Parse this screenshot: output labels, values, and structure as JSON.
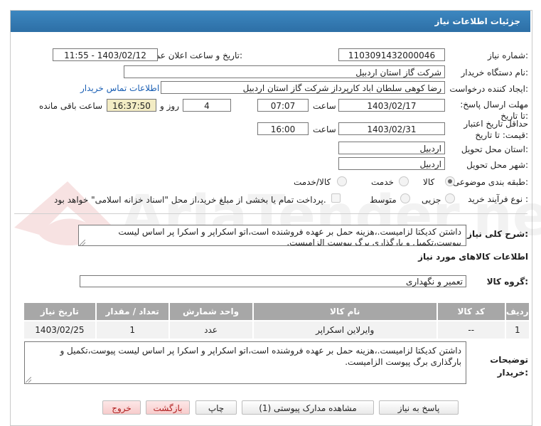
{
  "title": "جزئیات اطلاعات نیاز",
  "need_number": {
    "label": "شماره نیاز:",
    "value": "1103091432000046"
  },
  "announce": {
    "label": "تاریخ و ساعت اعلان عمومی:",
    "value": "1403/02/12 - 11:55"
  },
  "buyer": {
    "label": "نام دستگاه خریدار:",
    "value": "شرکت گاز استان اردبیل"
  },
  "creator": {
    "label": "ایجاد کننده درخواست:",
    "value": "رضا کوهی سلطان اباد کارپرداز شرکت گاز استان اردبیل",
    "contact_link": "اطلاعات تماس خریدار"
  },
  "deadline": {
    "label": "مهلت ارسال پاسخ: تا تاریخ:",
    "date": "1403/02/17",
    "time_label": "ساعت",
    "time": "07:07",
    "days": "4",
    "days_label": "روز و",
    "remaining": "16:37:50",
    "remaining_label": "ساعت باقی مانده"
  },
  "validity": {
    "label": "حداقل تاریخ اعتبار قیمت: تا تاریخ:",
    "date": "1403/02/31",
    "time_label": "ساعت",
    "time": "16:00"
  },
  "province": {
    "label": "استان محل تحویل:",
    "value": "اردبیل"
  },
  "city": {
    "label": "شهر محل تحویل:",
    "value": "اردبیل"
  },
  "category": {
    "label": "طبقه بندی موضوعی:",
    "options": [
      "کالا",
      "خدمت",
      "کالا/خدمت"
    ],
    "selected": "کالا"
  },
  "process": {
    "label": "نوع فرآیند خرید :",
    "options": [
      "جزیی",
      "متوسط"
    ],
    "selected": "جزیی",
    "checkbox_text": "پرداخت تمام یا بخشی از مبلغ خرید،از محل \"اسناد خزانه اسلامی\" خواهد بود."
  },
  "summary": {
    "label": "شرح کلی نیاز:",
    "value": "داشتن کدیکتا لزامیست.،هزینه حمل بر عهده فروشنده است،اتو اسکراپر و اسکرا پر اساس لیست پیوست،تکمیل و بارگذاری برگ پیوست الزامیست."
  },
  "goods_section": "اطلاعات کالاهای مورد نیاز",
  "goods_group": {
    "label": "گروه کالا:",
    "value": "تعمیر و نگهداری"
  },
  "table": {
    "headers": [
      "ردیف",
      "کد کالا",
      "نام کالا",
      "واحد شمارش",
      "تعداد / مقدار",
      "تاریخ نیاز"
    ],
    "rows": [
      [
        "1",
        "--",
        "وایرلاین اسکراپر",
        "عدد",
        "1",
        "1403/02/25"
      ]
    ]
  },
  "buyer_notes": {
    "label": "توضیحات خریدار:",
    "value": "داشتن کدیکتا لزامیست.،هزینه حمل بر عهده فروشنده است،اتو اسکراپر و اسکرا پر اساس لیست پیوست،تکمیل و بارگذاری برگ پیوست الزامیست."
  },
  "buttons": {
    "reply": "پاسخ به نیاز",
    "attachments": "مشاهده مدارک پیوستی (1)",
    "print": "چاپ",
    "back": "بازگشت",
    "exit": "خروج"
  },
  "watermark": "AriaTender.net",
  "colors": {
    "header": "#2d6fa6",
    "table_header": "#a7a7a7",
    "link": "#1a5fb4",
    "remaining_bg": "#f3ecc4"
  }
}
